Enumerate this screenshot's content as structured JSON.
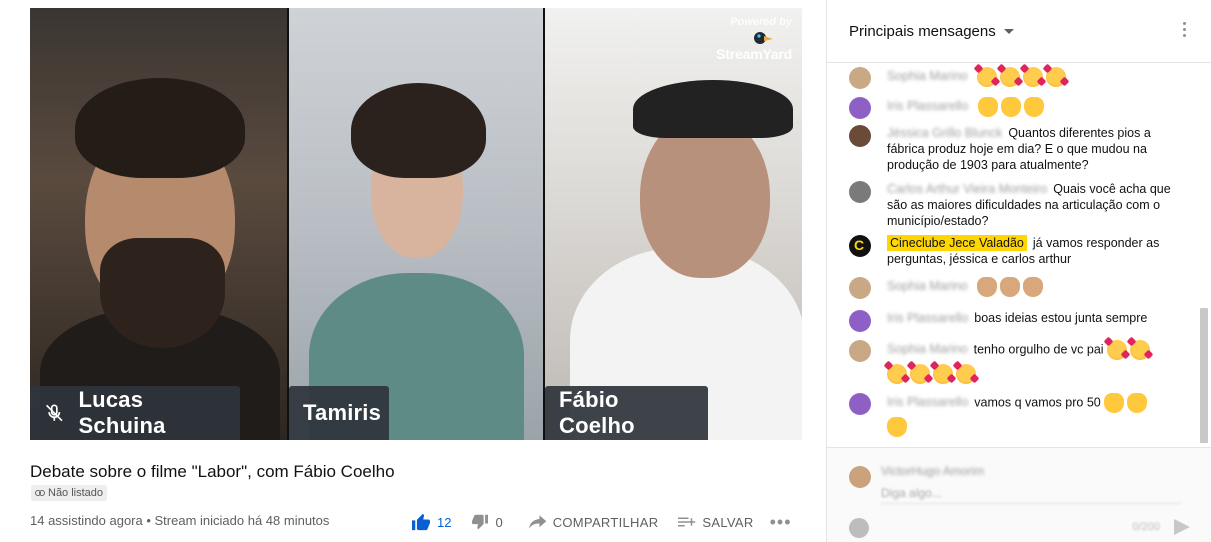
{
  "video": {
    "participants": [
      {
        "name": "Lucas Schuina",
        "muted": true
      },
      {
        "name": "Tamiris",
        "muted": false
      },
      {
        "name": "Fábio Coelho",
        "muted": false
      }
    ],
    "branding": {
      "powered_by": "Powered by",
      "name": "StreamYard"
    }
  },
  "info": {
    "title": "Debate sobre o filme \"Labor\", com Fábio Coelho",
    "visibility_badge": "Não listado",
    "viewers_line": "14 assistindo agora • Stream iniciado há 48 minutos"
  },
  "actions": {
    "like_count": "12",
    "dislike_count": "0",
    "share_label": "COMPARTILHAR",
    "save_label": "SALVAR",
    "more_label": "•••"
  },
  "chat": {
    "header_title": "Principais mensagens",
    "messages": [
      {
        "author": "Sophia Marino",
        "text": "",
        "emojis": "heart-eyes x4"
      },
      {
        "author": "Iris Plassarello",
        "text": "",
        "emojis": "wave x3"
      },
      {
        "author": "Jéssica Grillo Blunck",
        "text": "Quantos diferentes pios a fábrica produz hoje em dia? E o que mudou na produção de 1903 para atualmente?"
      },
      {
        "author": "Carlos Arthur Vieira Monteiro",
        "text": "Quais você acha que são as maiores dificuldades na articulação com o município/estado?"
      },
      {
        "author": "Cineclube Jece Valadão",
        "text": "já vamos responder as perguntas, jéssica e carlos arthur",
        "owner": true
      },
      {
        "author": "Sophia Marino",
        "text": "",
        "emojis": "wave x3"
      },
      {
        "author": "Iris Plassarello",
        "text": "boas ideias estou junta sempre"
      },
      {
        "author": "Sophia Marino",
        "text": "tenho orgulho de vc pai"
      },
      {
        "author": "Iris Plassarello",
        "text": "vamos q vamos pro 50"
      }
    ],
    "input": {
      "user": "VictorHugo Amorim",
      "placeholder": "Diga algo...",
      "counter": "0/200"
    }
  },
  "colors": {
    "like_blue": "#065fd4",
    "owner_highlight": "#ffd600",
    "name_tag_bg": "#2f343c"
  },
  "icons": [
    "mic-off-icon",
    "thumbs-up-icon",
    "thumbs-down-icon",
    "share-icon",
    "save-playlist-icon",
    "more-icon",
    "caret-down-icon",
    "kebab-icon",
    "send-icon",
    "link-icon"
  ]
}
